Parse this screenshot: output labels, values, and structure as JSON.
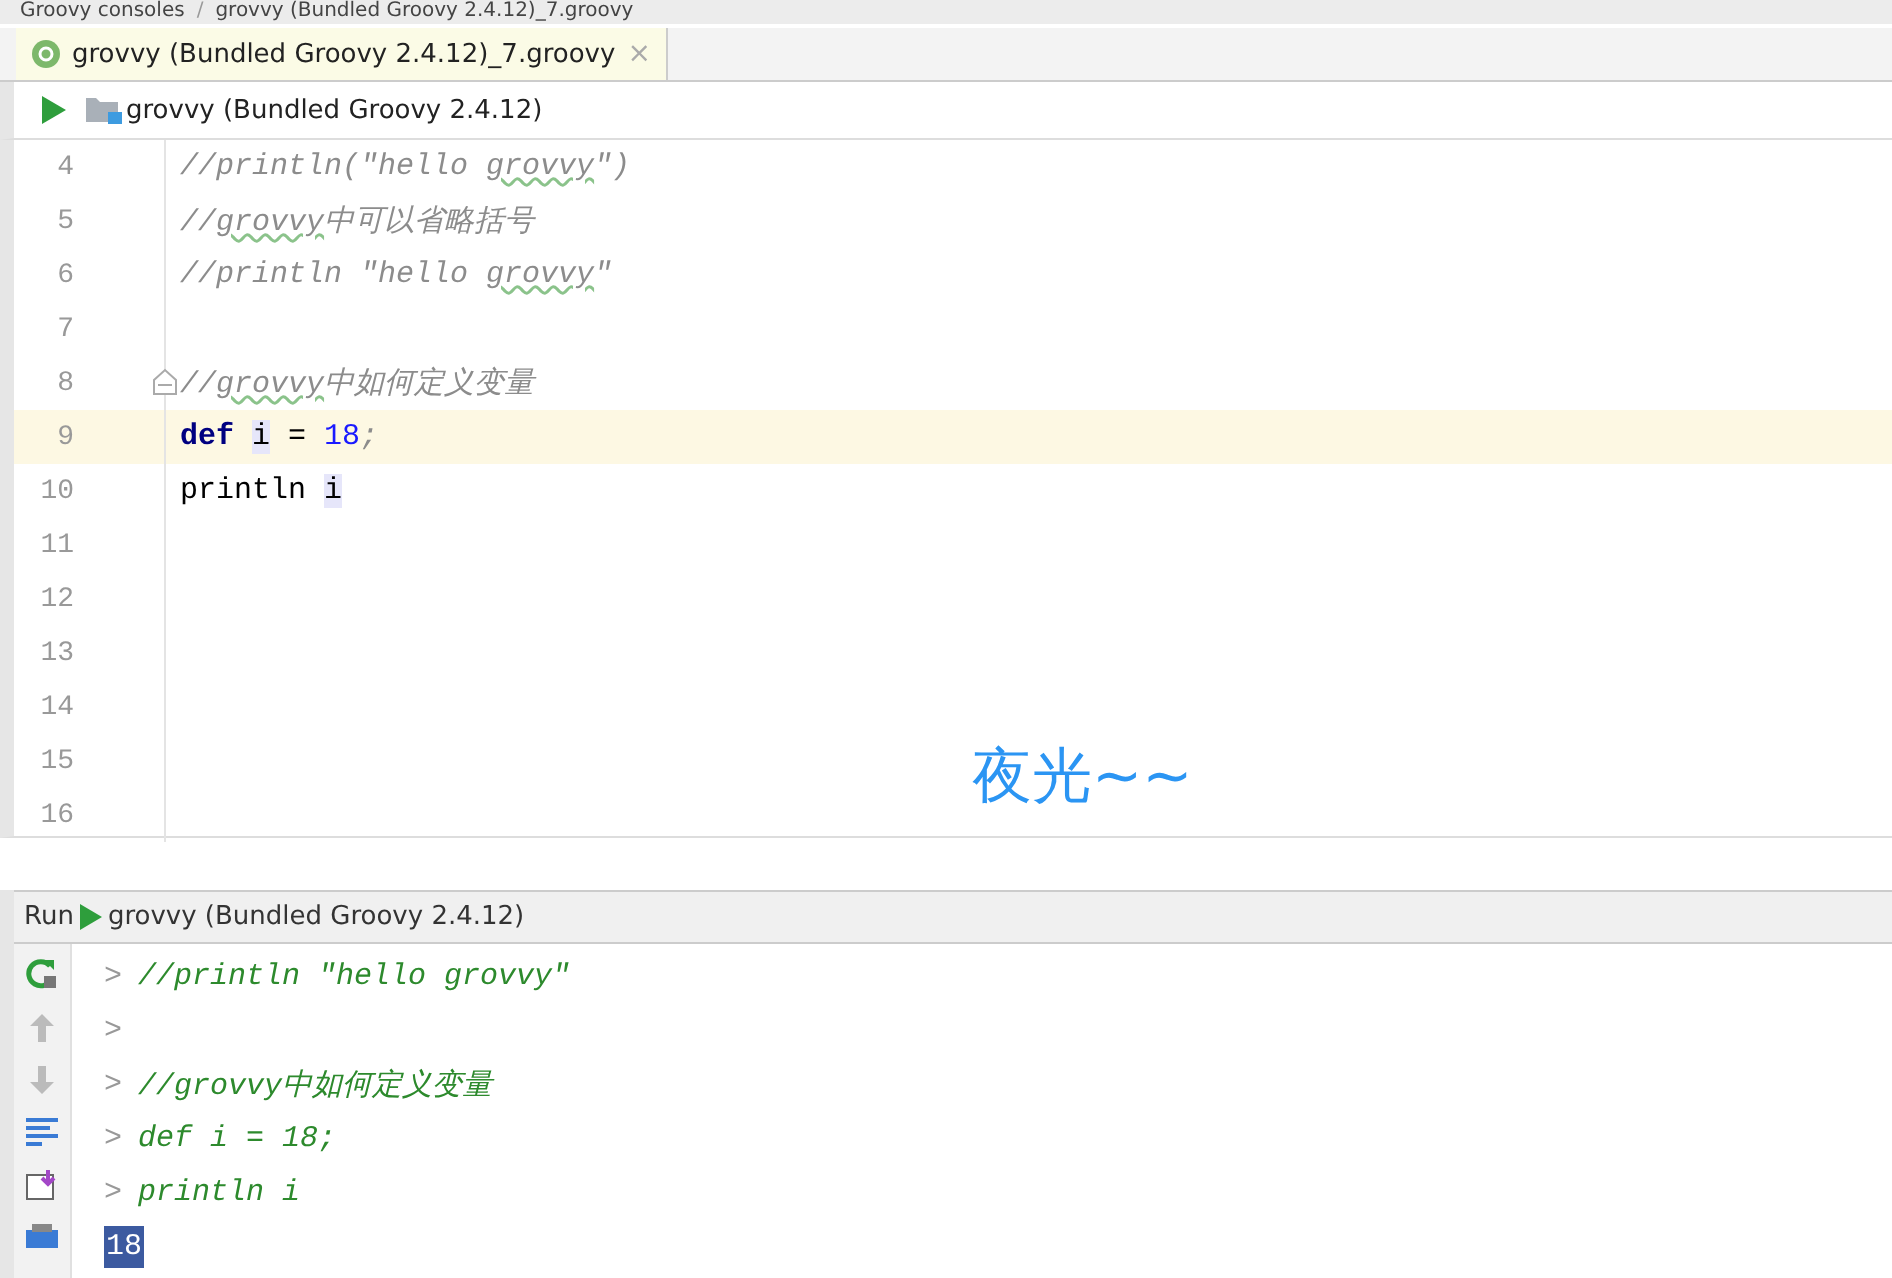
{
  "breadcrumbs": {
    "separator": "/",
    "items": [
      {
        "label": "Groovy consoles"
      },
      {
        "label": "grovvy (Bundled Groovy 2.4.12)_7.groovy"
      }
    ]
  },
  "tabs": [
    {
      "label": "grovvy (Bundled Groovy 2.4.12)_7.groovy",
      "close": "×",
      "selected": true
    }
  ],
  "toolbar": {
    "config": "grovvy (Bundled Groovy 2.4.12)"
  },
  "editor": {
    "lines": [
      {
        "number": "4",
        "current": false,
        "fold": false,
        "tokens": [
          {
            "kind": "comment",
            "text": "//println(\"hello "
          },
          {
            "kind": "typo",
            "text": "grovvy"
          },
          {
            "kind": "comment",
            "text": "\")"
          }
        ]
      },
      {
        "number": "5",
        "current": false,
        "fold": false,
        "tokens": [
          {
            "kind": "comment",
            "text": "//"
          },
          {
            "kind": "typo",
            "text": "grovvy"
          },
          {
            "kind": "comment",
            "text": "中可以省略括号"
          }
        ]
      },
      {
        "number": "6",
        "current": false,
        "fold": false,
        "tokens": [
          {
            "kind": "comment",
            "text": "//println \"hello "
          },
          {
            "kind": "typo",
            "text": "grovvy"
          },
          {
            "kind": "comment",
            "text": "\""
          }
        ]
      },
      {
        "number": "7",
        "current": false,
        "fold": false
      },
      {
        "number": "8",
        "current": false,
        "fold": true,
        "tokens": [
          {
            "kind": "comment",
            "text": "//"
          },
          {
            "kind": "typo",
            "text": "grovvy"
          },
          {
            "kind": "comment",
            "text": "中如何定义变量"
          }
        ]
      },
      {
        "number": "9",
        "current": true,
        "fold": false,
        "tokens": [
          {
            "kind": "keyword",
            "text": "def "
          },
          {
            "kind": "usage",
            "text": "i"
          },
          {
            "kind": "plain",
            "text": " = "
          },
          {
            "kind": "number",
            "text": "18"
          },
          {
            "kind": "comment",
            "text": ";"
          }
        ]
      },
      {
        "number": "10",
        "current": false,
        "fold": false,
        "tokens": [
          {
            "kind": "plain",
            "text": "println "
          },
          {
            "kind": "usage",
            "text": "i"
          }
        ]
      },
      {
        "number": "11",
        "current": false,
        "fold": false
      },
      {
        "number": "12",
        "current": false,
        "fold": false
      },
      {
        "number": "13",
        "current": false,
        "fold": false
      },
      {
        "number": "14",
        "current": false,
        "fold": false
      },
      {
        "number": "15",
        "current": false,
        "fold": false
      },
      {
        "number": "16",
        "current": false,
        "fold": false
      }
    ],
    "overlay_caption": "夜光~~"
  },
  "run_panel": {
    "label": "Run",
    "config": "grovvy (Bundled Groovy 2.4.12)",
    "lines": [
      {
        "kind": "input",
        "prompt": ">",
        "text": "//println \"hello grovvy\""
      },
      {
        "kind": "input",
        "prompt": ">"
      },
      {
        "kind": "input",
        "prompt": ">",
        "text": "//grovvy中如何定义变量"
      },
      {
        "kind": "input",
        "prompt": ">",
        "text": "def i = 18;"
      },
      {
        "kind": "input",
        "prompt": ">",
        "text": "println i"
      },
      {
        "kind": "output",
        "text": "18",
        "selected": true
      }
    ]
  }
}
